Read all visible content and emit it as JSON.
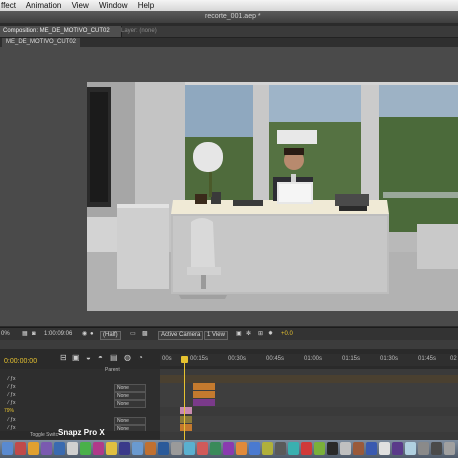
{
  "menubar": {
    "items": [
      "ffect",
      "Animation",
      "View",
      "Window",
      "Help"
    ],
    "document_title": "recorte_001.aep *"
  },
  "panel_tabs": {
    "composition": "Composition: ME_DE_MOTIVO_CUT02",
    "layer": "Layer: (none)",
    "sub_tab": "ME_DE_MOTIVO_CUT02"
  },
  "viewer_toolbar": {
    "zoom": "0%",
    "timecode": "1:00:09:06",
    "resolution": "(Half)",
    "camera": "Active Camera",
    "views": "1 View",
    "exposure": "+0.0"
  },
  "timeline": {
    "current_time": "0:00:00:00",
    "ruler_ticks": [
      "00s",
      "00:15s",
      "00:30s",
      "00:45s",
      "01:00s",
      "01:15s",
      "01:30s",
      "01:45s",
      "02"
    ],
    "parent_header": "Parent",
    "parent_value": "None",
    "percent_label": "79%",
    "toggle_label": "Toggle Switc"
  },
  "watermark": "Snapz Pro X",
  "colors": {
    "accent_yellow": "#e6c230",
    "bar_orange": "#c47a2e",
    "bar_purple": "#7a3a8a",
    "bar_pink": "#c98bb0",
    "bar_olive": "#8a7a3a"
  }
}
